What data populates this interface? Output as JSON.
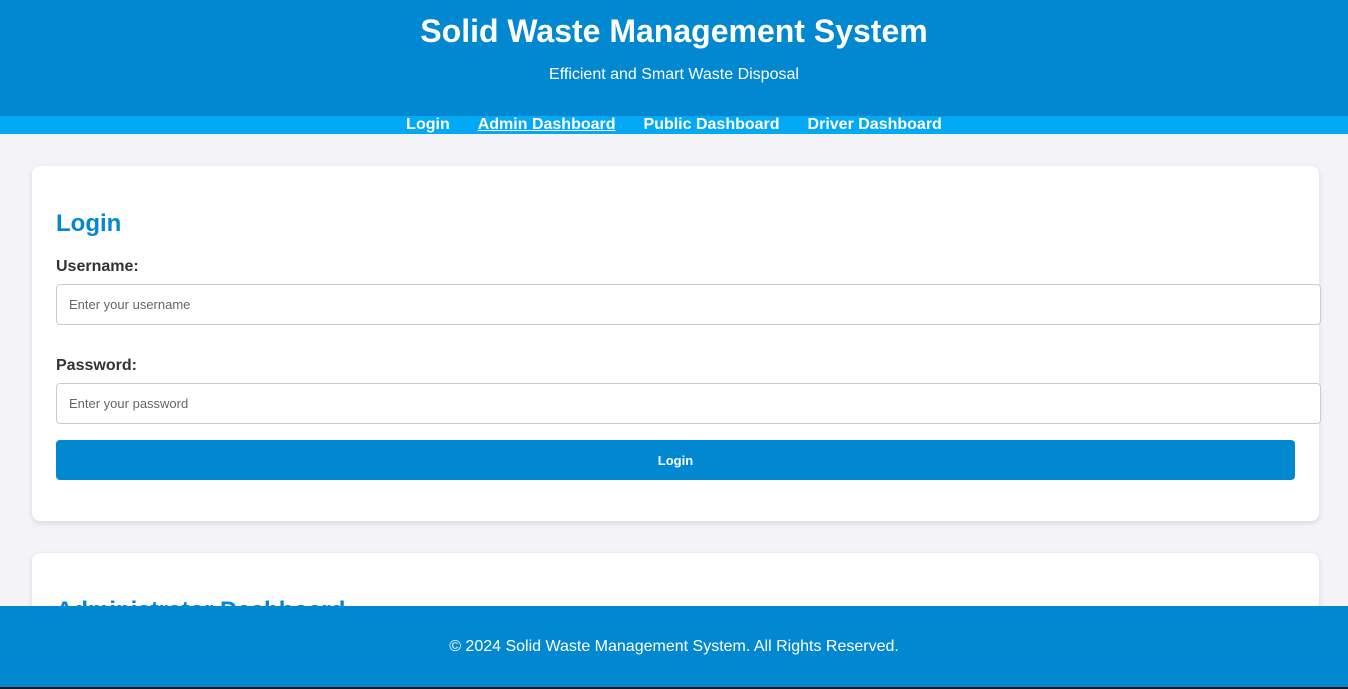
{
  "header": {
    "title": "Solid Waste Management System",
    "subtitle": "Efficient and Smart Waste Disposal"
  },
  "nav": {
    "items": [
      {
        "label": "Login"
      },
      {
        "label": "Admin Dashboard",
        "active": true
      },
      {
        "label": "Public Dashboard"
      },
      {
        "label": "Driver Dashboard"
      }
    ]
  },
  "login": {
    "title": "Login",
    "username_label": "Username:",
    "username_placeholder": "Enter your username",
    "username_value": "",
    "password_label": "Password:",
    "password_placeholder": "Enter your password",
    "password_value": "",
    "button_label": "Login"
  },
  "admin": {
    "title": "Administrator Dashboard"
  },
  "footer": {
    "text": "© 2024 Solid Waste Management System. All Rights Reserved."
  },
  "colors": {
    "primary": "#0288d1",
    "nav_bar": "#03a9f4",
    "page_background": "#f4f4f8"
  }
}
